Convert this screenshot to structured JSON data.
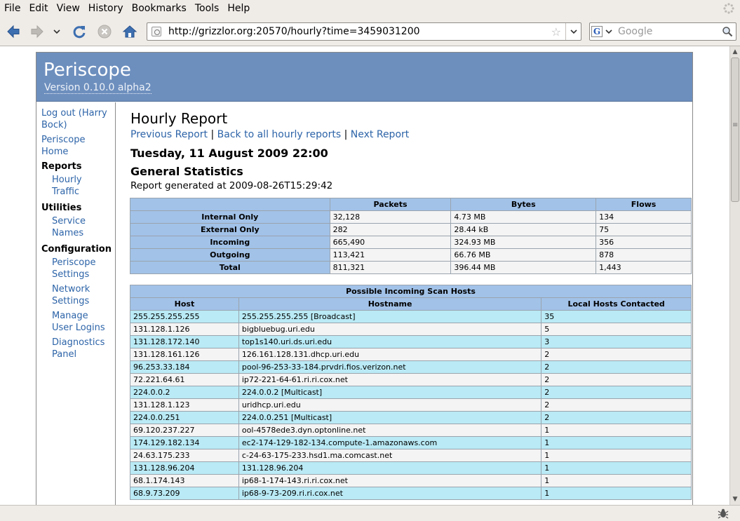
{
  "browser": {
    "menu": [
      "File",
      "Edit",
      "View",
      "History",
      "Bookmarks",
      "Tools",
      "Help"
    ],
    "url": "http://grizzlor.org:20570/hourly?time=3459031200",
    "search_placeholder": "Google",
    "icons": [
      "back-arrow-icon",
      "forward-arrow-icon",
      "history-dropdown-icon",
      "reload-icon",
      "stop-icon",
      "home-icon",
      "bookmark-star-icon",
      "search-magnifier-icon"
    ]
  },
  "header": {
    "title": "Periscope",
    "version": "Version 0.10.0 alpha2"
  },
  "sidebar": {
    "logout": "Log out (Harry Bock)",
    "home": "Periscope Home",
    "reports_heading": "Reports",
    "hourly": "Hourly Traffic",
    "utilities_heading": "Utilities",
    "service_names": "Service Names",
    "configuration_heading": "Configuration",
    "periscope_settings": "Periscope Settings",
    "network_settings": "Network Settings",
    "manage_logins": "Manage User Logins",
    "diagnostics": "Diagnostics Panel"
  },
  "report": {
    "title": "Hourly Report",
    "prev": "Previous Report",
    "back": "Back to all hourly reports",
    "next": "Next Report",
    "sep": "|",
    "date": "Tuesday, 11 August 2009 22:00",
    "stats_heading": "General Statistics",
    "generated": "Report generated at 2009-08-26T15:29:42"
  },
  "stats_table": {
    "headers": [
      "",
      "Packets",
      "Bytes",
      "Flows"
    ],
    "rows": [
      [
        "Internal Only",
        "32,128",
        "4.73 MB",
        "134"
      ],
      [
        "External Only",
        "282",
        "28.44 kB",
        "75"
      ],
      [
        "Incoming",
        "665,490",
        "324.93 MB",
        "356"
      ],
      [
        "Outgoing",
        "113,421",
        "66.76 MB",
        "878"
      ],
      [
        "Total",
        "811,321",
        "396.44 MB",
        "1,443"
      ]
    ]
  },
  "scan_table": {
    "caption": "Possible Incoming Scan Hosts",
    "headers": [
      "Host",
      "Hostname",
      "Local Hosts Contacted"
    ],
    "rows": [
      [
        "255.255.255.255",
        "255.255.255.255 [Broadcast]",
        "35"
      ],
      [
        "131.128.1.126",
        "bigbluebug.uri.edu",
        "5"
      ],
      [
        "131.128.172.140",
        "top1s140.uri.ds.uri.edu",
        "3"
      ],
      [
        "131.128.161.126",
        "126.161.128.131.dhcp.uri.edu",
        "2"
      ],
      [
        "96.253.33.184",
        "pool-96-253-33-184.prvdri.fios.verizon.net",
        "2"
      ],
      [
        "72.221.64.61",
        "ip72-221-64-61.ri.ri.cox.net",
        "2"
      ],
      [
        "224.0.0.2",
        "224.0.0.2 [Multicast]",
        "2"
      ],
      [
        "131.128.1.123",
        "uridhcp.uri.edu",
        "2"
      ],
      [
        "224.0.0.251",
        "224.0.0.251 [Multicast]",
        "2"
      ],
      [
        "69.120.237.227",
        "ool-4578ede3.dyn.optonline.net",
        "1"
      ],
      [
        "174.129.182.134",
        "ec2-174-129-182-134.compute-1.amazonaws.com",
        "1"
      ],
      [
        "24.63.175.233",
        "c-24-63-175-233.hsd1.ma.comcast.net",
        "1"
      ],
      [
        "131.128.96.204",
        "131.128.96.204",
        "1"
      ],
      [
        "68.1.174.143",
        "ip68-1-174-143.ri.ri.cox.net",
        "1"
      ],
      [
        "68.9.73.209",
        "ip68-9-73-209.ri.ri.cox.net",
        "1"
      ]
    ]
  }
}
